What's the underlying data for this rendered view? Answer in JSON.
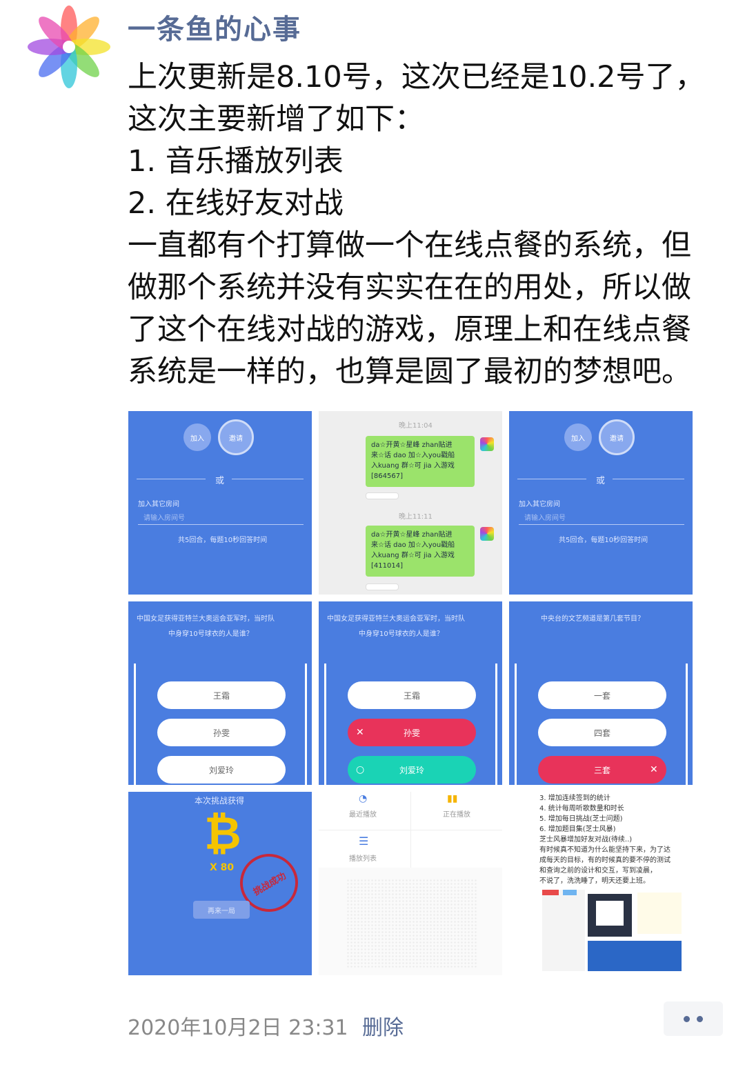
{
  "post": {
    "author": "一条鱼的心事",
    "lines": [
      "上次更新是8.10号，这次已经是10.2号了，",
      "这次主要新增了如下：",
      "1. 音乐播放列表",
      "2. 在线好友对战",
      "一直都有个打算做一个在线点餐的系统，但",
      "做那个系统并没有实实在在的用处，所以做",
      "了这个在线对战的游戏，原理上和在线点餐",
      "系统是一样的，也算是圆了最初的梦想吧。"
    ],
    "timestamp": "2020年10月2日 23:31",
    "delete_label": "删除"
  },
  "images": {
    "t1": {
      "btn_left": "加入",
      "btn_right": "邀请",
      "divider": "或",
      "join_label": "加入其它房间",
      "input_placeholder": "请输入房间号",
      "rule": "共5回合，每题10秒回答时间"
    },
    "t2": {
      "time1": "晚上11:04",
      "msg1": [
        "da☆开黄☆星峰 zhan贴进",
        "来☆话 dao 加☆入you戳船",
        "入kuang 群☆可 jia 入游戏",
        "[864567]"
      ],
      "time2": "晚上11:11",
      "msg2": [
        "da☆开黄☆星峰 zhan贴进",
        "来☆话 dao 加☆入you戳船",
        "入kuang 群☆可 jia 入游戏",
        "[411014]"
      ]
    },
    "t3": {
      "btn_left": "加入",
      "btn_right": "邀请",
      "divider": "或",
      "join_label": "加入其它房间",
      "input_placeholder": "请输入房间号",
      "rule": "共5回合，每题10秒回答时间"
    },
    "t4": {
      "question": [
        "中国女足获得亚特兰大奥运会亚军时，当时队",
        "中身穿10号球衣的人是谁？"
      ],
      "options": [
        "王霜",
        "孙雯",
        "刘爱玲"
      ]
    },
    "t5": {
      "question": [
        "中国女足获得亚特兰大奥运会亚军时，当时队",
        "中身穿10号球衣的人是谁？"
      ],
      "options": [
        "王霜",
        "孙雯",
        "刘爱玲"
      ]
    },
    "t6": {
      "question": [
        "中央台的文艺频道是第几套节目？"
      ],
      "options": [
        "一套",
        "四套",
        "三套"
      ]
    },
    "t7": {
      "title": "本次挑战获得",
      "coin_count": "X 80",
      "stamp": "挑战成功",
      "button": "再来一局"
    },
    "t8": {
      "item1": "最近播放",
      "item2": "正在播放",
      "item3": "播放列表"
    },
    "t9": {
      "lines": [
        "3. 增加连续签到的统计",
        "4. 统计每周听歌数量和时长",
        "5. 增加每日挑战(芝士问题)",
        "6. 增加题目集(芝士风暴)",
        "芝士风暴增加好友对战(待续..)",
        "有时候真不知道为什么能坚持下来，为了达",
        "成每天的目标，有的时候真的要不停的测试",
        "和查询之前的设计和交互，写到凌晨，",
        "不说了，洗洗睡了，明天还要上班。"
      ]
    }
  },
  "colors": {
    "link": "#576b95",
    "tile_blue": "#4a7de0",
    "wrong": "#e8335a",
    "right": "#1ad3b5"
  }
}
